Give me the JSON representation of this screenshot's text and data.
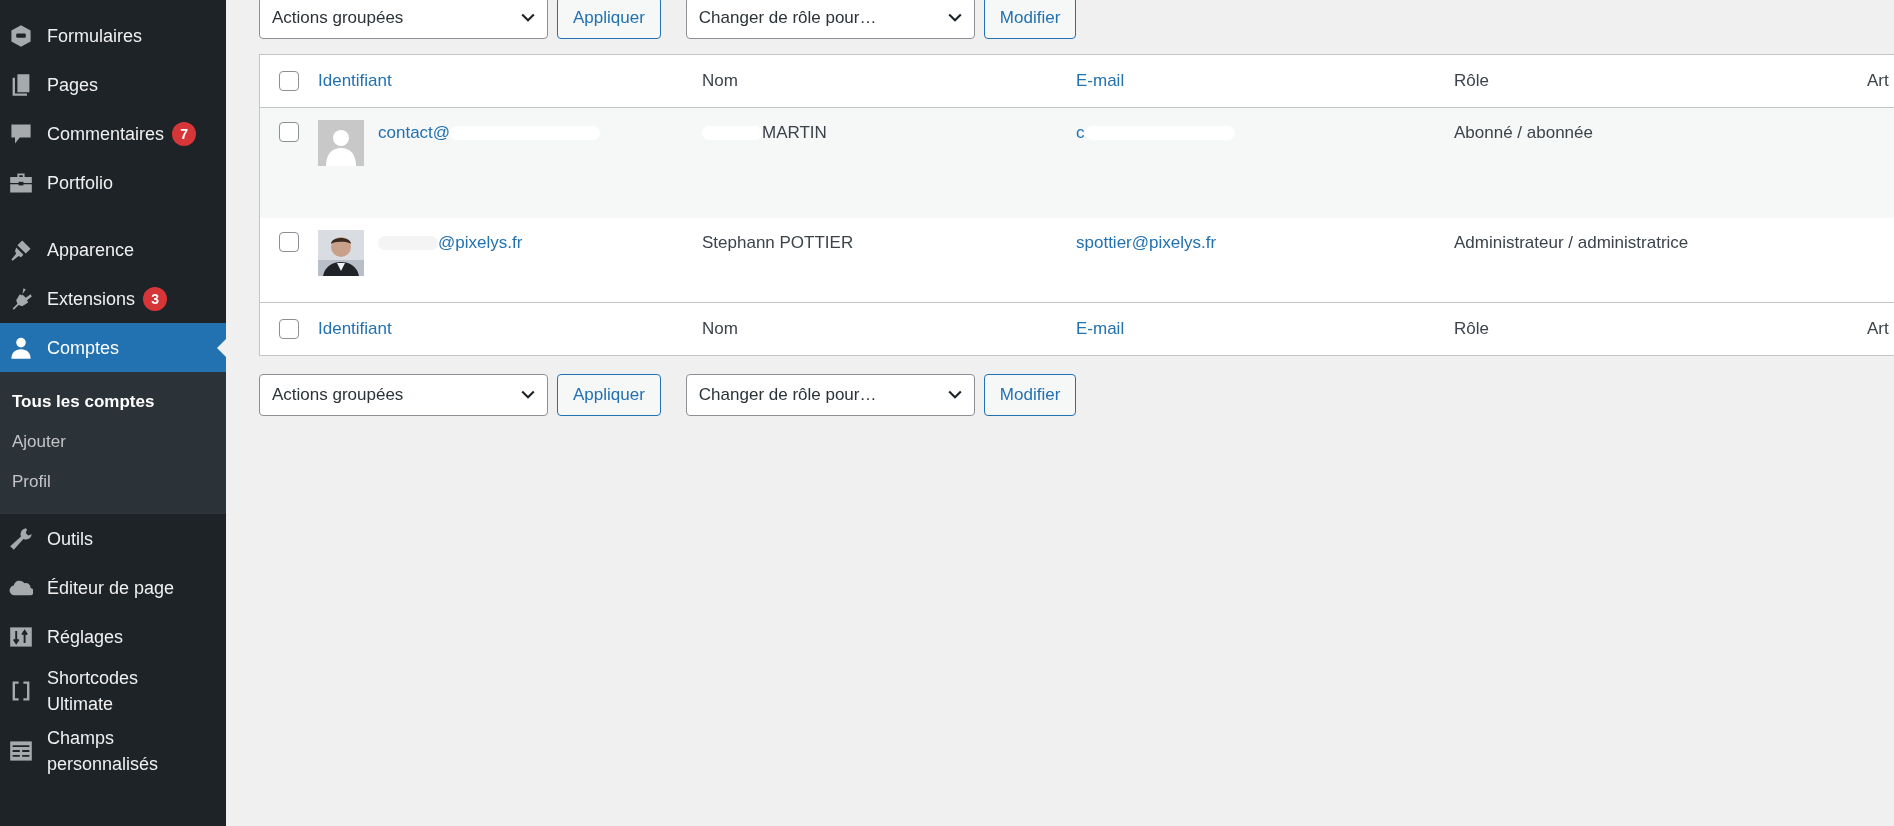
{
  "sidebar": {
    "items": [
      {
        "kind": "forms",
        "label": "Formulaires",
        "selected": false
      },
      {
        "kind": "pages",
        "label": "Pages",
        "selected": false
      },
      {
        "kind": "comments",
        "label": "Commentaires",
        "badge": "7",
        "selected": false
      },
      {
        "kind": "portfolio",
        "label": "Portfolio",
        "selected": false
      },
      {
        "kind": "separator"
      },
      {
        "kind": "appearance",
        "label": "Apparence",
        "selected": false
      },
      {
        "kind": "plugins",
        "label": "Extensions",
        "badge": "3",
        "selected": false
      },
      {
        "kind": "users",
        "label": "Comptes",
        "selected": true,
        "children": [
          {
            "label": "Tous les comptes",
            "selected": true
          },
          {
            "label": "Ajouter",
            "selected": false
          },
          {
            "label": "Profil",
            "selected": false
          }
        ]
      },
      {
        "kind": "tools",
        "label": "Outils",
        "selected": false
      },
      {
        "kind": "editor",
        "label": "Éditeur de page",
        "selected": false
      },
      {
        "kind": "settings",
        "label": "Réglages",
        "selected": false
      },
      {
        "kind": "shortcodes",
        "label": "Shortcodes Ultimate",
        "selected": false
      },
      {
        "kind": "fields",
        "label": "Champs personnalisés",
        "selected": false
      }
    ]
  },
  "top_actions": {
    "bulk_select": "Actions groupées",
    "apply_button": "Appliquer",
    "role_select": "Changer de rôle pour…",
    "role_button": "Modifier"
  },
  "table": {
    "select_all_checked": false,
    "columns": [
      {
        "label": "Identifiant",
        "sortable": true
      },
      {
        "label": "Nom",
        "sortable": false
      },
      {
        "label": "E-mail",
        "sortable": true
      },
      {
        "label": "Rôle",
        "sortable": false
      },
      {
        "label": "Art",
        "sortable": false
      }
    ],
    "rows": [
      {
        "checked": false,
        "has_photo": false,
        "login": {
          "text": "contact@",
          "redacted_after": true
        },
        "name": {
          "text": "MARTIN",
          "redacted_before": true
        },
        "email": {
          "text": "c",
          "redacted_after": true
        },
        "role": "Abonné / abonnée"
      },
      {
        "checked": false,
        "has_photo": true,
        "login": {
          "text": "@pixelys.fr",
          "redacted_before": true
        },
        "name": {
          "text": "Stephann POTTIER"
        },
        "email": {
          "text": "spottier@pixelys.fr"
        },
        "role": "Administrateur / administratrice"
      }
    ],
    "footer_select_all_checked": false,
    "footer_columns": [
      {
        "label": "Identifiant",
        "sortable": true
      },
      {
        "label": "Nom",
        "sortable": false
      },
      {
        "label": "E-mail",
        "sortable": true
      },
      {
        "label": "Rôle",
        "sortable": false
      },
      {
        "label": "Art",
        "sortable": false
      }
    ]
  },
  "bottom_actions": {
    "bulk_select": "Actions groupées",
    "apply_button": "Appliquer",
    "role_select": "Changer de rôle pour…",
    "role_button": "Modifier"
  }
}
